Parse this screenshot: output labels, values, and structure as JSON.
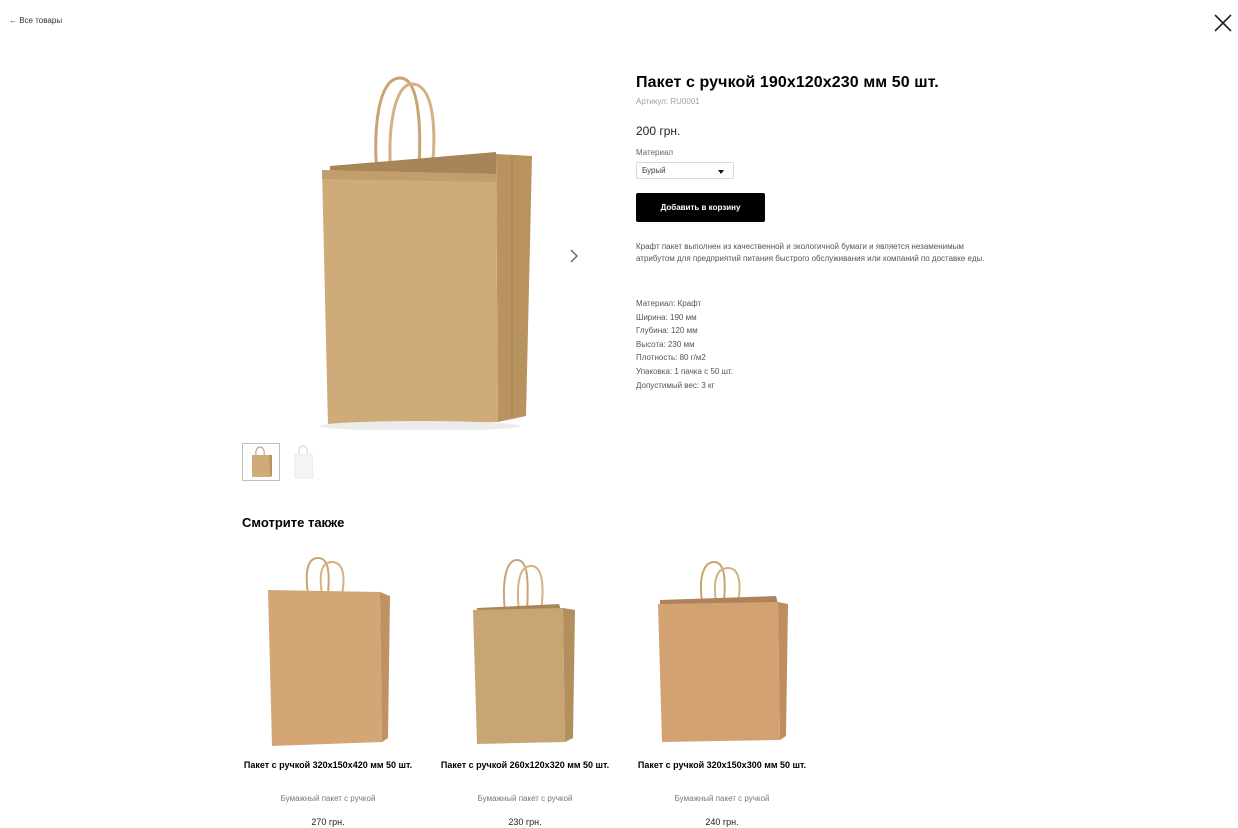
{
  "nav": {
    "back_label": "← Все товары"
  },
  "product": {
    "title": "Пакет с ручкой 190х120х230 мм 50 шт.",
    "sku": "Артикул: RU0001",
    "price": "200 грн.",
    "material_label": "Материал",
    "material_value": "Бурый",
    "add_to_cart": "Добавить в корзину",
    "description": "Крафт пакет выполнен из качественной и экологичной бумаги и является незаменимым атрибутом для предприятий питания быстрого обслуживания или компаний по доставке еды.",
    "specs": [
      "Материал: Крафт",
      "Ширина: 190 мм",
      "Глубина: 120 мм",
      "Высота: 230 мм",
      "Плотность: 80 г/м2",
      "Упаковка: 1 пачка с 50 шт.",
      "Допустимый вес: 3 кг"
    ]
  },
  "gallery": {
    "active_thumb": 0,
    "thumbs": [
      "kraft-bag-thumb",
      "white-bag-thumb"
    ]
  },
  "see_also": {
    "heading": "Смотрите также",
    "items": [
      {
        "name": "Пакет с ручкой 320х150х420 мм 50 шт.",
        "subtitle": "Бумажный пакет с ручкой",
        "price": "270 грн."
      },
      {
        "name": "Пакет с ручкой 260х120х320 мм 50 шт.",
        "subtitle": "Бумажный пакет с ручкой",
        "price": "230 грн."
      },
      {
        "name": "Пакет с ручкой 320х150х300 мм 50 шт.",
        "subtitle": "Бумажный пакет с ручкой",
        "price": "240 грн."
      }
    ]
  },
  "colors": {
    "accent": "#000000",
    "kraft": "#cfab7a",
    "kraft_dark": "#b8925f",
    "muted_text": "#555555"
  },
  "icons": {
    "close": "close-icon",
    "next": "chevron-right-icon",
    "dropdown": "caret-down-icon"
  }
}
